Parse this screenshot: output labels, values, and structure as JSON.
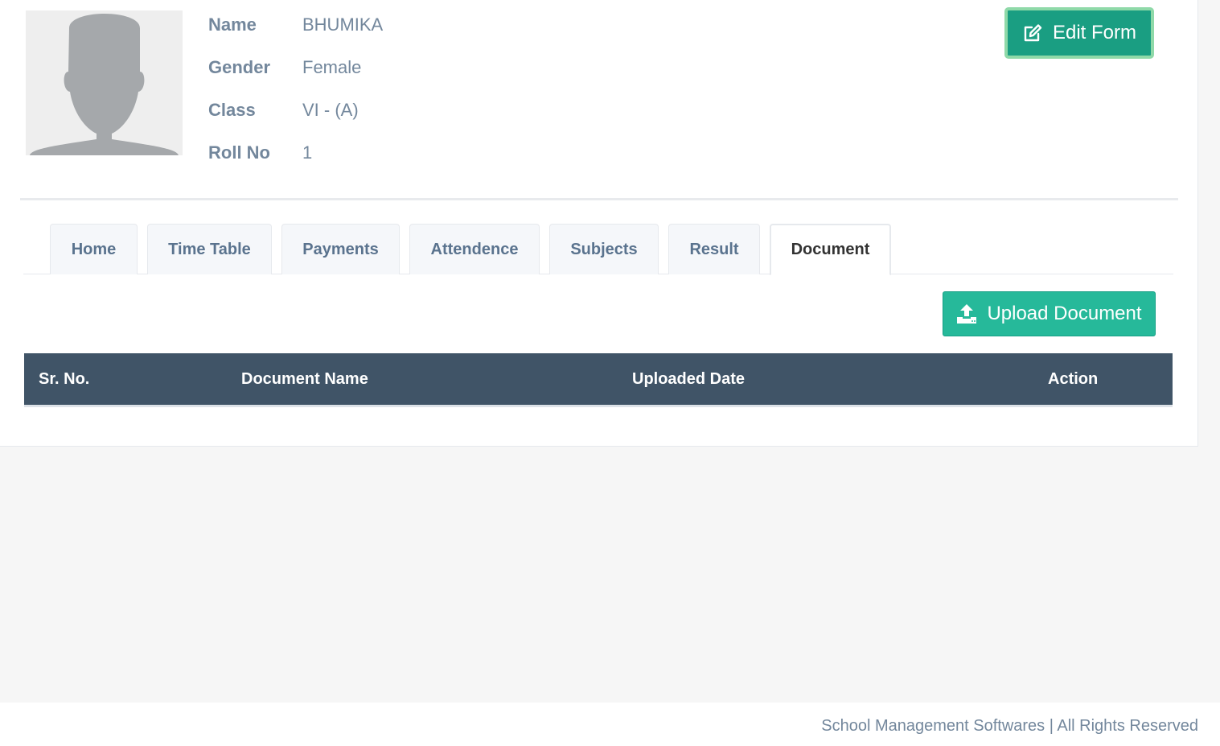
{
  "student": {
    "fields": [
      {
        "label": "Name",
        "value": "BHUMIKA"
      },
      {
        "label": "Gender",
        "value": "Female"
      },
      {
        "label": "Class",
        "value": "VI - (A)"
      },
      {
        "label": "Roll No",
        "value": "1"
      }
    ],
    "avatar_icon": "user-silhouette-icon"
  },
  "actions": {
    "edit_label": "Edit Form",
    "edit_icon": "edit-icon",
    "upload_label": "Upload Document",
    "upload_icon": "upload-icon"
  },
  "tabs": [
    {
      "label": "Home"
    },
    {
      "label": "Time Table"
    },
    {
      "label": "Payments"
    },
    {
      "label": "Attendence"
    },
    {
      "label": "Subjects"
    },
    {
      "label": "Result"
    },
    {
      "label": "Document",
      "active": true
    }
  ],
  "table": {
    "columns": [
      "Sr. No.",
      "Document Name",
      "Uploaded Date",
      "Action"
    ],
    "rows": []
  },
  "footer": {
    "text": "School Management Softwares | All Rights Reserved"
  },
  "colors": {
    "header_bg": "#405467",
    "primary_green": "#26b99a",
    "edit_green": "#1a9e82"
  }
}
